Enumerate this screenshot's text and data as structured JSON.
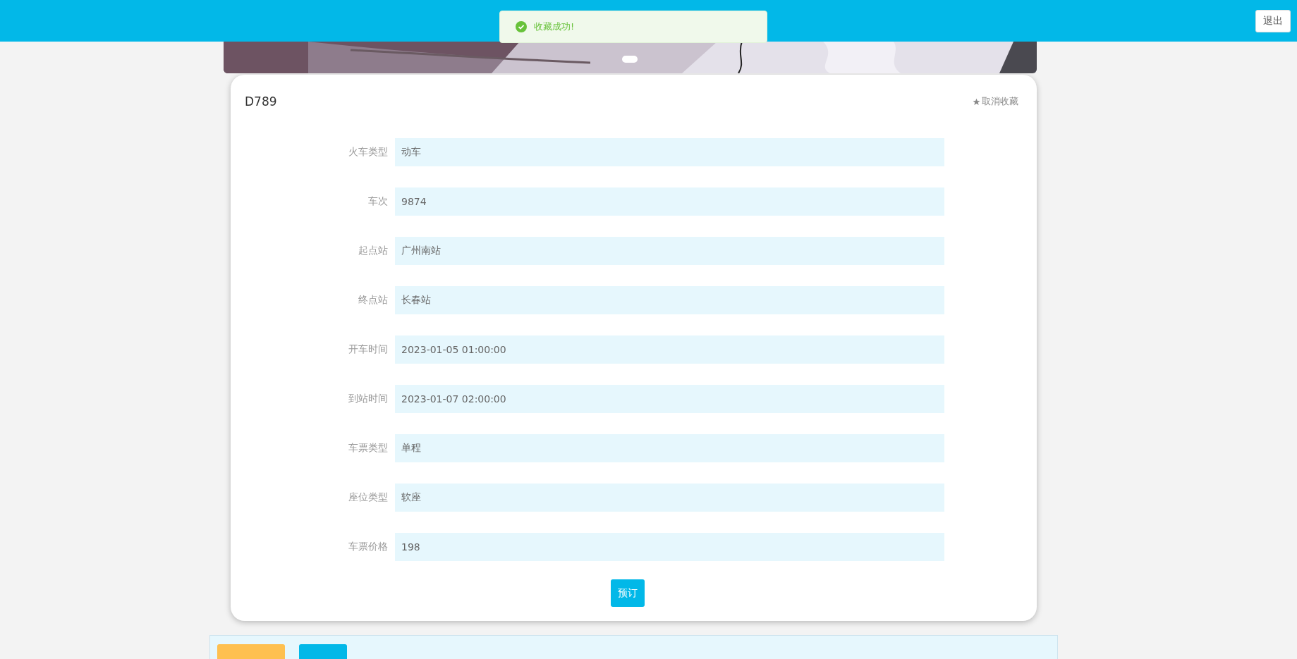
{
  "header": {
    "logout_button": "退出"
  },
  "toast": {
    "kind": "success",
    "message": "收藏成功!"
  },
  "detail": {
    "title": "D789",
    "favorite_action": "取消收藏",
    "fields": [
      {
        "label": "火车类型",
        "value": "动车"
      },
      {
        "label": "车次",
        "value": "9874"
      },
      {
        "label": "起点站",
        "value": "广州南站"
      },
      {
        "label": "终点站",
        "value": "长春站"
      },
      {
        "label": "开车时间",
        "value": "2023-01-05 01:00:00"
      },
      {
        "label": "到站时间",
        "value": "2023-01-07 02:00:00"
      },
      {
        "label": "车票类型",
        "value": "单程"
      },
      {
        "label": "座位类型",
        "value": "软座"
      },
      {
        "label": "车票价格",
        "value": "198"
      }
    ],
    "book_button": "预订"
  },
  "bottom_tabs": [
    {
      "color": "#fec050"
    },
    {
      "color": "#02b8e8"
    }
  ]
}
